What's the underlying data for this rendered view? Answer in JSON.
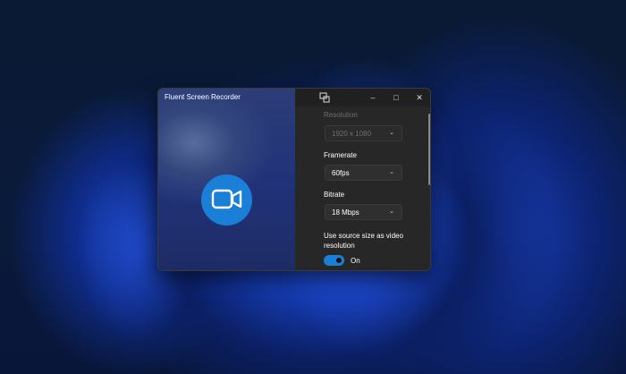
{
  "window": {
    "title": "Fluent Screen Recorder"
  },
  "settings": {
    "resolution": {
      "label": "Resolution",
      "value": "1920 x 1080",
      "enabled": false
    },
    "framerate": {
      "label": "Framerate",
      "value": "60fps"
    },
    "bitrate": {
      "label": "Bitrate",
      "value": "18 Mbps"
    },
    "source_size": {
      "label": "Use source size as video resolution",
      "toggle_state": "On"
    }
  },
  "colors": {
    "accent": "#1a7fd6"
  }
}
